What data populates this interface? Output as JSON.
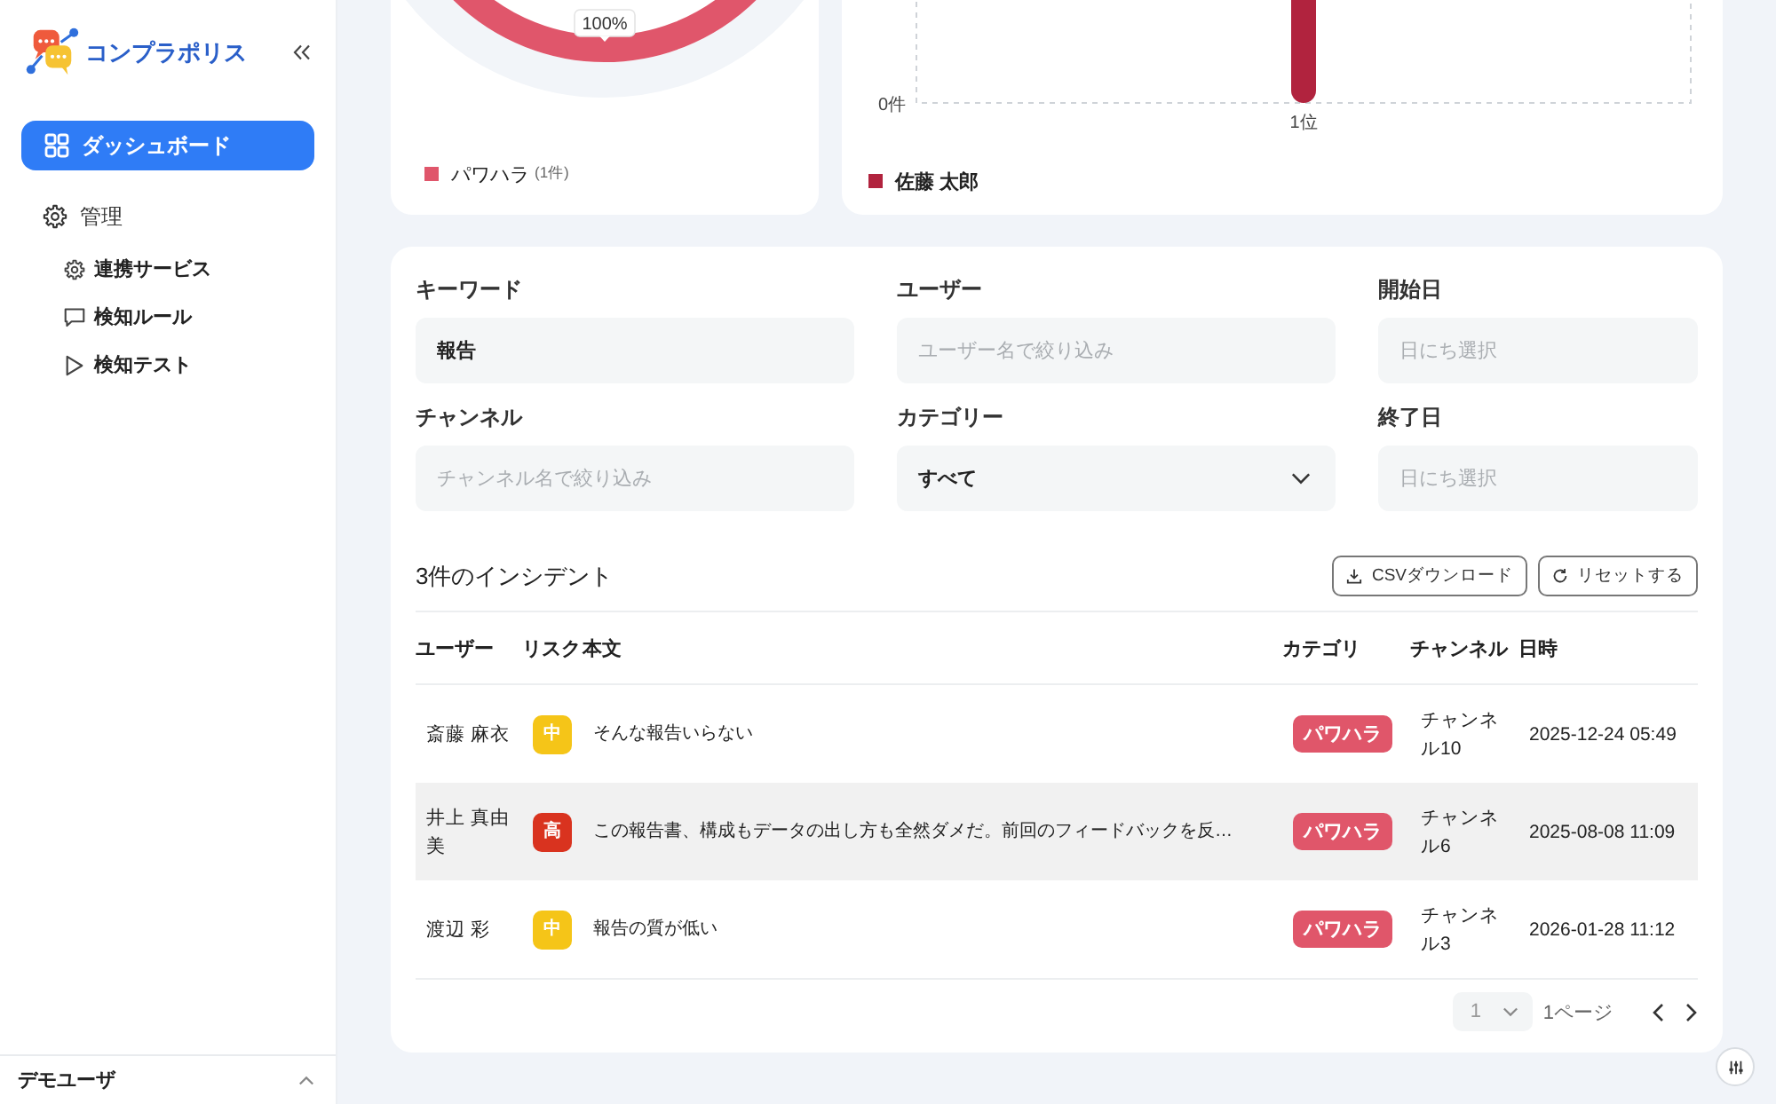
{
  "sidebar": {
    "app_name": "コンプラポリス",
    "nav": [
      {
        "label": "ダッシュボード",
        "selected": true
      },
      {
        "label": "管理",
        "selected": false,
        "children": [
          {
            "label": "連携サービス",
            "selected": false
          },
          {
            "label": "検知ルール",
            "selected": false
          },
          {
            "label": "検知テスト",
            "selected": false
          }
        ]
      }
    ],
    "user": "デモユーザ"
  },
  "category_chart": {
    "ring_label": "100%",
    "legend": [
      {
        "label": "パワハラ",
        "count": "(1件)",
        "color": "#e0566b"
      }
    ]
  },
  "ranking_chart": {
    "y_axis_label": "0件",
    "x_labels": [
      "1位"
    ],
    "legend": [
      {
        "name": "佐藤 太郎",
        "color": "#b1233e"
      }
    ]
  },
  "filters": [
    {
      "label": "キーワード",
      "kind": "text",
      "value": "報告"
    },
    {
      "label": "ユーザー",
      "kind": "text",
      "placeholder": "ユーザー名で絞り込み"
    },
    {
      "label": "開始日",
      "kind": "text",
      "placeholder": "日にち選択"
    },
    {
      "label": "チャンネル",
      "kind": "text",
      "placeholder": "チャンネル名で絞り込み"
    },
    {
      "label": "カテゴリー",
      "kind": "select",
      "value": "すべて"
    },
    {
      "label": "終了日",
      "kind": "text",
      "placeholder": "日にち選択"
    }
  ],
  "incidents": {
    "title": "3件のインシデント",
    "actions": [
      {
        "label": "CSVダウンロード"
      },
      {
        "label": "リセットする"
      }
    ],
    "columns": [
      "ユーザー",
      "リスク",
      "本文",
      "カテゴリ",
      "チャンネル",
      "日時"
    ],
    "rows": [
      {
        "user": "斎藤 麻衣",
        "risk": {
          "label": "中",
          "color": "#f5c518"
        },
        "text": "そんな報告いらない",
        "category": "パワハラ",
        "channel": "チャンネル10",
        "datetime": "2025-12-24 05:49",
        "highlighted": false
      },
      {
        "user": "井上 真由美",
        "risk": {
          "label": "高",
          "color": "#d9331f"
        },
        "text": "この報告書、構成もデータの出し方も全然ダメだ。前回のフィードバックを反…",
        "category": "パワハラ",
        "channel": "チャンネル6",
        "datetime": "2025-08-08 11:09",
        "highlighted": true
      },
      {
        "user": "渡辺 彩",
        "risk": {
          "label": "中",
          "color": "#f5c518"
        },
        "text": "報告の質が低い",
        "category": "パワハラ",
        "channel": "チャンネル3",
        "datetime": "2026-01-28 11:12",
        "highlighted": false
      }
    ],
    "pagination": {
      "page": "1",
      "label": "1ページ"
    }
  }
}
